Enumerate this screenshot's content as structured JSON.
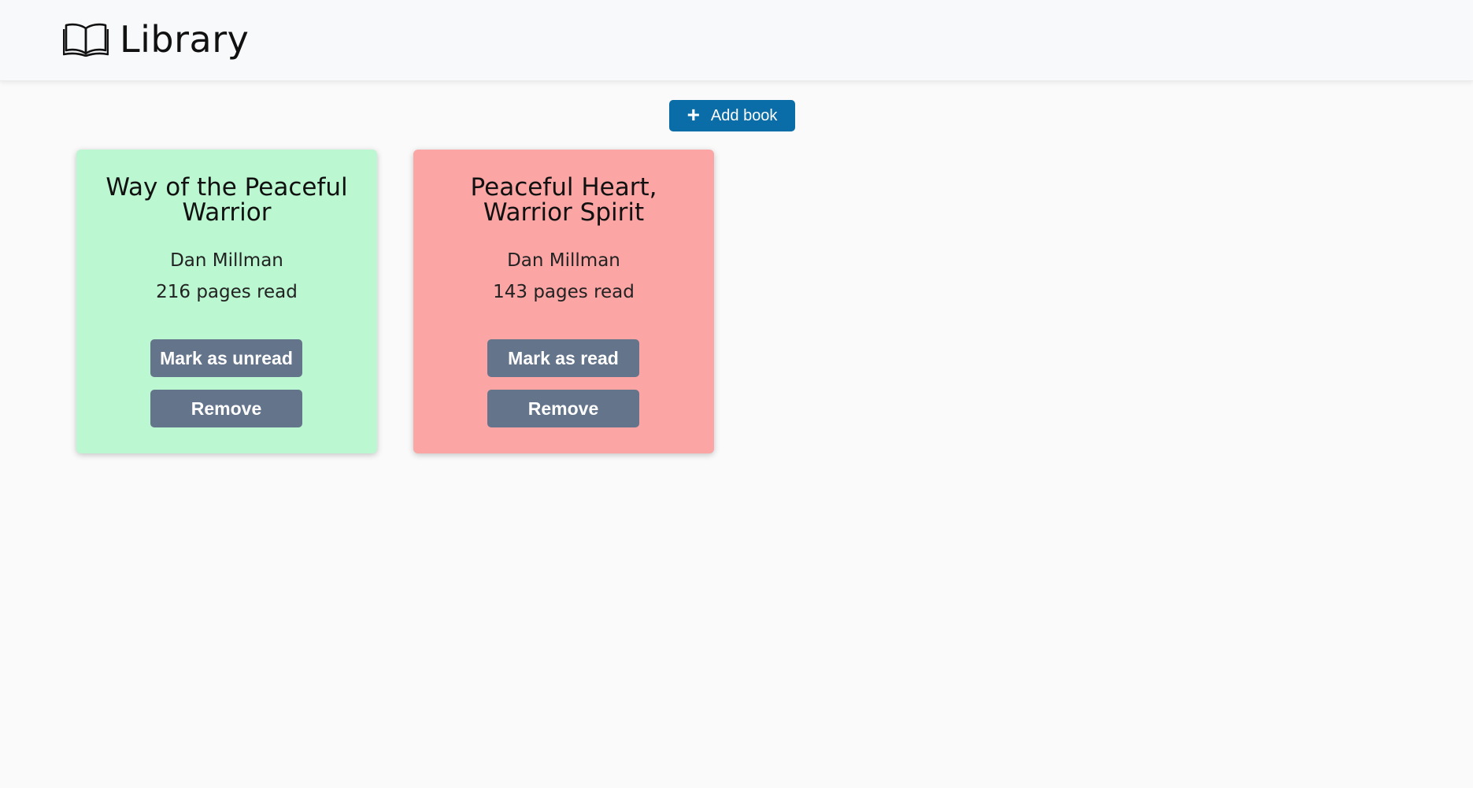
{
  "header": {
    "title": "Library",
    "icon": "open-book-icon"
  },
  "toolbar": {
    "add_icon": "plus-icon",
    "add_label": "Add book",
    "add_color": "#0b6da8"
  },
  "colors": {
    "read_card": "#bbf7d0",
    "unread_card": "#fca5a5",
    "button": "#64748b"
  },
  "books": [
    {
      "title": "Way of the Peaceful Warrior",
      "author": "Dan Millman",
      "pages": "216 pages read",
      "status": "read",
      "toggle_label": "Mark as unread",
      "remove_label": "Remove"
    },
    {
      "title": "Peaceful Heart, Warrior Spirit",
      "author": "Dan Millman",
      "pages": "143 pages read",
      "status": "unread",
      "toggle_label": "Mark as read",
      "remove_label": "Remove"
    }
  ]
}
